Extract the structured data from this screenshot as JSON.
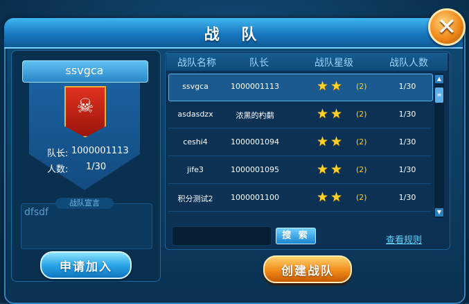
{
  "window": {
    "title": "战 队",
    "close_icon": "close-icon"
  },
  "team_card": {
    "name": "ssvgca",
    "leader_label": "队长:",
    "leader_value": "1000001113",
    "members_label": "人数:",
    "members_value": "1/30",
    "declaration_label": "战队宣言",
    "declaration_text": "dfsdf",
    "join_button": "申请加入"
  },
  "table": {
    "headers": [
      "战队名称",
      "队长",
      "战队星级",
      "战队人数"
    ],
    "rows": [
      {
        "name": "ssvgca",
        "leader": "1000001113",
        "stars": 2,
        "level": "(2)",
        "members": "1/30",
        "selected": true
      },
      {
        "name": "asdasdzx",
        "leader": "浓黑的杓鹬",
        "stars": 2,
        "level": "(2)",
        "members": "1/30",
        "selected": false
      },
      {
        "name": "ceshi4",
        "leader": "1000001094",
        "stars": 2,
        "level": "(2)",
        "members": "1/30",
        "selected": false
      },
      {
        "name": "jife3",
        "leader": "1000001095",
        "stars": 2,
        "level": "(2)",
        "members": "1/30",
        "selected": false
      },
      {
        "name": "积分测试2",
        "leader": "1000001100",
        "stars": 2,
        "level": "(2)",
        "members": "1/30",
        "selected": false
      }
    ]
  },
  "search": {
    "placeholder": "",
    "button": "搜 索"
  },
  "rules_link": "查看规则",
  "create_button": "创建战队",
  "colors": {
    "accent_orange": "#f08a1a",
    "accent_blue": "#2aa6e8",
    "star": "#ffd22e"
  }
}
